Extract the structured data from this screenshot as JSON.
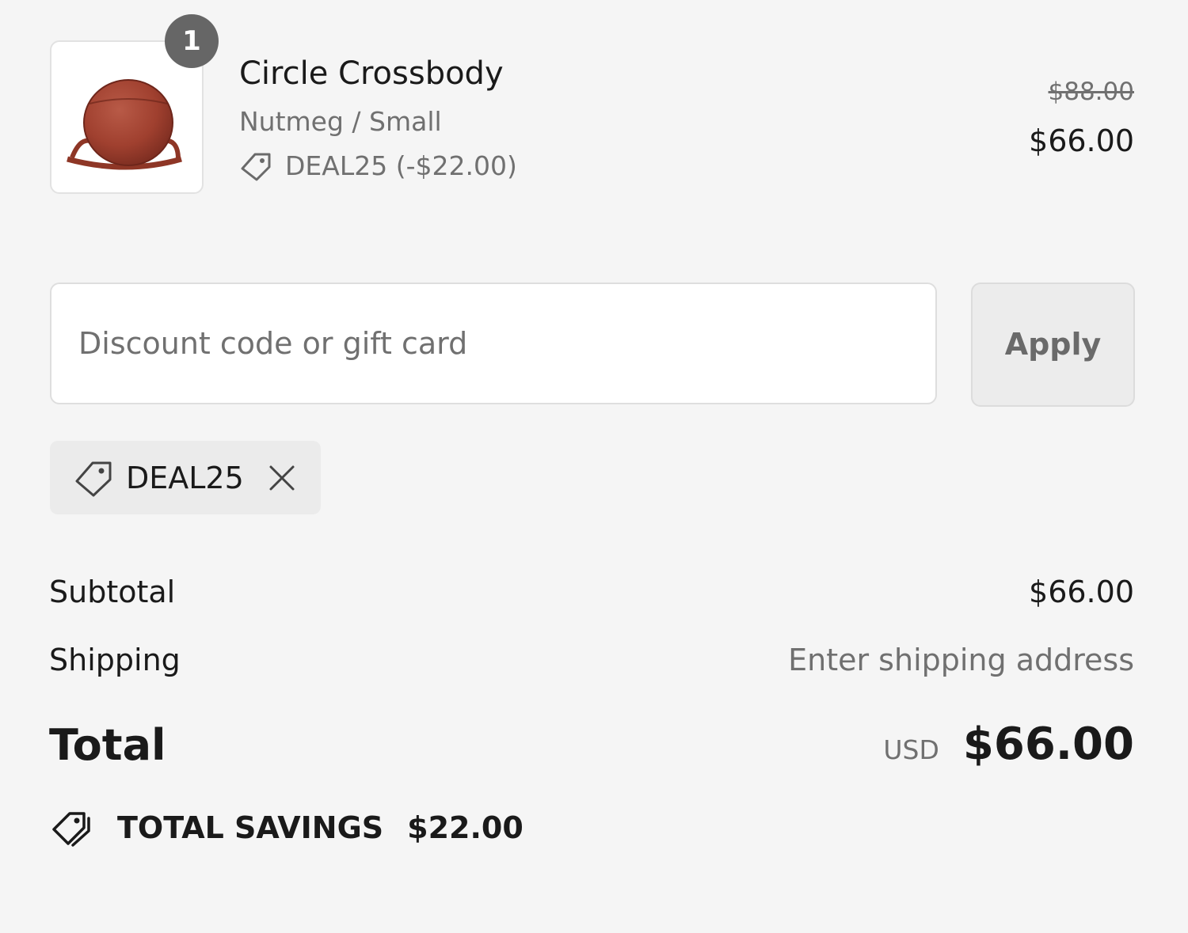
{
  "line_item": {
    "quantity": "1",
    "title": "Circle Crossbody",
    "variant": "Nutmeg / Small",
    "discount_allocation": "DEAL25 (-$22.00)",
    "original_price": "$88.00",
    "price": "$66.00",
    "image_icon": "bag-thumbnail",
    "discount_icon": "tag-icon"
  },
  "discount": {
    "input_value": "",
    "placeholder": "Discount code or gift card",
    "apply_label": "Apply",
    "applied_code": "DEAL25",
    "remove_icon": "close-icon"
  },
  "summary": {
    "subtotal_label": "Subtotal",
    "subtotal_value": "$66.00",
    "shipping_label": "Shipping",
    "shipping_value": "Enter shipping address",
    "total_label": "Total",
    "currency": "USD",
    "total_value": "$66.00",
    "savings_label": "TOTAL SAVINGS",
    "savings_value": "$22.00",
    "savings_icon": "tags-icon"
  },
  "colors": {
    "background": "#f5f5f5",
    "badge": "#666666",
    "muted_text": "#707070",
    "product_leather": "#a0402f"
  }
}
